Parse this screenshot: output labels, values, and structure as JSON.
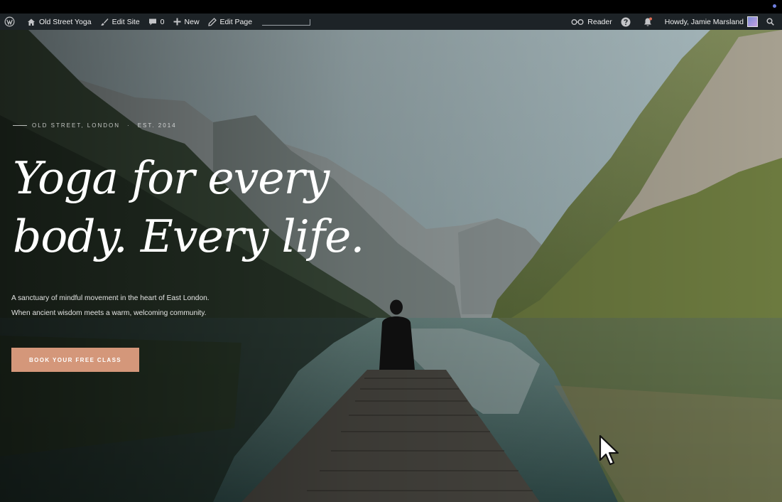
{
  "admin_bar": {
    "site_name": "Old Street Yoga",
    "edit_site": "Edit Site",
    "comments_count": "0",
    "new_label": "New",
    "edit_page": "Edit Page",
    "reader": "Reader",
    "greeting": "Howdy, Jamie Marsland",
    "icons": [
      "wordpress-logo-icon",
      "home-icon",
      "brush-icon",
      "comment-icon",
      "plus-icon",
      "pencil-icon",
      "glasses-icon",
      "help-icon",
      "bell-icon",
      "avatar",
      "search-icon"
    ]
  },
  "hero": {
    "eyebrow_location": "OLD STREET, LONDON",
    "eyebrow_est": "EST. 2014",
    "heading_line1": "Yoga for every",
    "heading_line2": "body. Every life.",
    "description_line1": "A sanctuary of mindful movement in the heart of East London.",
    "description_line2": "When ancient wisdom meets a warm, welcoming community.",
    "cta_label": "BOOK YOUR FREE CLASS"
  },
  "colors": {
    "admin_bar": "#1d2327",
    "cta": "#d4977a",
    "text": "#ffffff"
  }
}
